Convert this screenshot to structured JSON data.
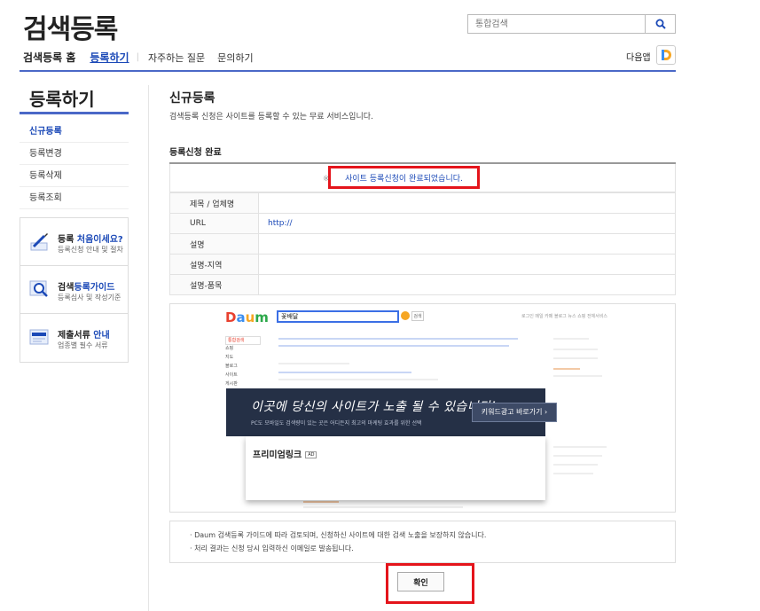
{
  "header": {
    "logo": "검색등록",
    "search_placeholder": "통합검색",
    "next_app_label": "다음앱"
  },
  "gnb": {
    "home": "검색등록 홈",
    "register": "등록하기",
    "separator": "|",
    "faq": "자주하는 질문",
    "contact": "문의하기"
  },
  "sidebar": {
    "title": "등록하기",
    "items": [
      {
        "label": "신규등록",
        "active": true
      },
      {
        "label": "등록변경",
        "active": false
      },
      {
        "label": "등록삭제",
        "active": false
      },
      {
        "label": "등록조회",
        "active": false
      }
    ],
    "boxes": [
      {
        "title_plain": "등록 ",
        "title_blue": "처음이세요?",
        "title_after": "",
        "desc": "등록신청 안내 및 절차",
        "icon": "pencil-icon"
      },
      {
        "title_plain": "검색",
        "title_blue": "등록가이드",
        "title_after": "",
        "desc": "등록심사 및 작성기준",
        "icon": "magnifier-icon"
      },
      {
        "title_plain": "제출서류 ",
        "title_blue": "안내",
        "title_after": "",
        "desc": "업종별 필수 서류",
        "icon": "document-icon"
      }
    ]
  },
  "main": {
    "title": "신규등록",
    "description": "검색등록 신청은 사이트를 등록할 수 있는 무료 서비스입니다.",
    "section_title": "등록신청 완료",
    "done_bullet": "※",
    "done_message": "사이트 등록신청이 완료되었습니다.",
    "table": [
      {
        "label": "제목 / 업체명",
        "value": ""
      },
      {
        "label": "URL",
        "value": "http://"
      },
      {
        "label": "설명",
        "value": ""
      },
      {
        "label": "설명-지역",
        "value": ""
      },
      {
        "label": "설명-품목",
        "value": ""
      }
    ],
    "preview": {
      "logo": "Daum",
      "query": "꽃배달",
      "search_btn": "검색",
      "right_links": "로그인  메일 카페 블로그 뉴스 쇼핑  전체서비스",
      "side_items": [
        "통합검색",
        "쇼핑",
        "지도",
        "블로그",
        "사이트",
        "게시판",
        "지식",
        "이미지",
        "동영상"
      ],
      "headline": "이곳에 당신의 사이트가 노출 될 수 있습니다!",
      "subline": "PC도 모바일도 검색량이 있는 곳은 어디든지 최고의 마케팅 효과를 위한 선택",
      "cta": "키워드광고 바로가기 ›",
      "premium": "프리미엄링크",
      "ad_badge": "AD"
    },
    "notes": [
      "· Daum 검색등록 가이드에 따라 검토되며, 신청하신 사이트에 대한 검색 노출을 보장하지 않습니다.",
      "· 처리 결과는 신청 당시 입력하신 이메일로 발송됩니다."
    ],
    "confirm_button": "확인"
  },
  "colors": {
    "accent_blue": "#1b49b7",
    "nav_line": "#4a68c7",
    "highlight_red": "#e4141b"
  }
}
